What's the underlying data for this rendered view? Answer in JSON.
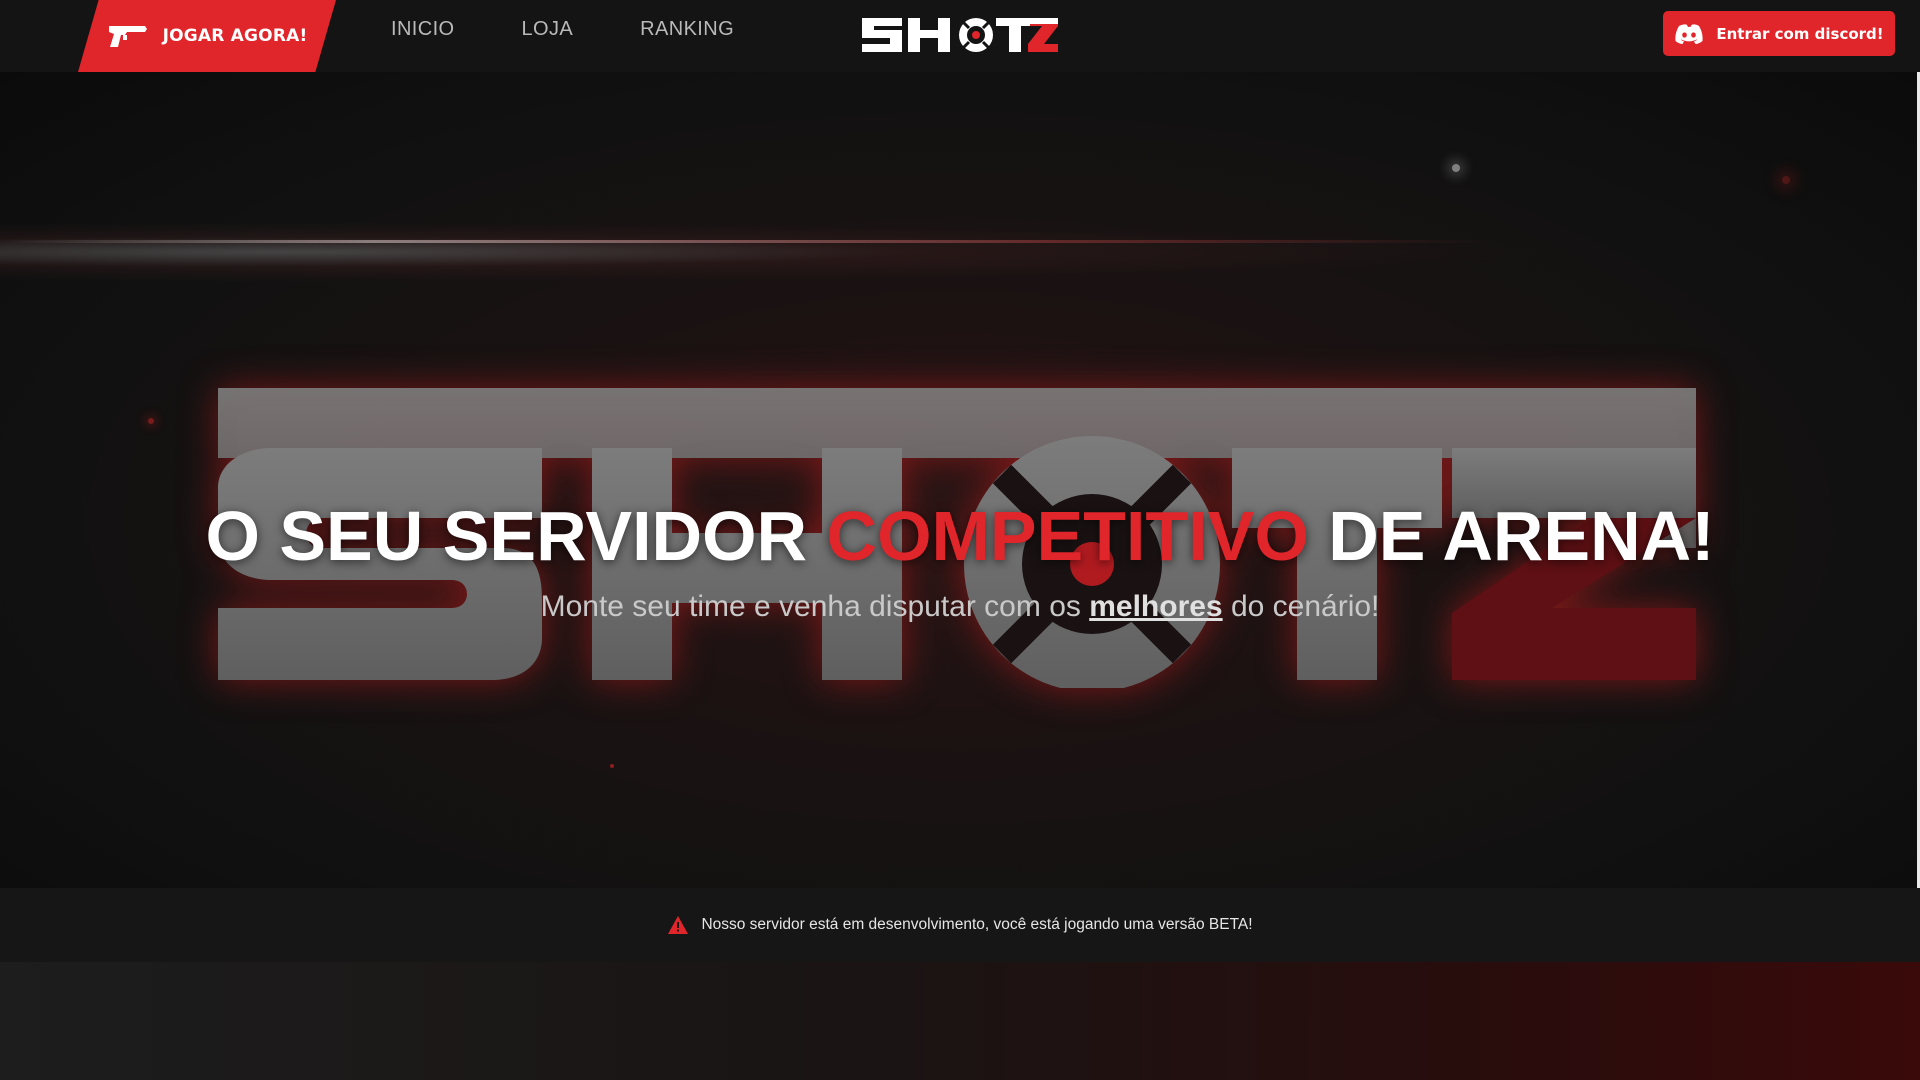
{
  "navbar": {
    "play_button": {
      "label": "JOGAR AGORA!",
      "icon": "pistol-icon"
    },
    "links": [
      {
        "label": "INICIO"
      },
      {
        "label": "LOJA"
      },
      {
        "label": "RANKING"
      }
    ],
    "logo_text": "SHOTZ",
    "discord_button": {
      "label": "Entrar com discord!",
      "icon": "discord-icon"
    }
  },
  "hero": {
    "background_logo_text": "SHOTZ",
    "headline": {
      "part1": "O SEU SERVIDOR",
      "accent": "COMPETITIVO",
      "part2": "DE ARENA!"
    },
    "subtitle": {
      "before": "Monte seu time e venha disputar com os",
      "highlight": "melhores",
      "after": "do cenário!"
    }
  },
  "beta_notice": {
    "icon": "warning-icon",
    "text": "Nosso servidor está em desenvolvimento, você está jogando uma versão BETA!"
  },
  "colors": {
    "accent": "#e0252b",
    "navbar_bg": "#141414",
    "page_bg": "#0c0c0c"
  }
}
